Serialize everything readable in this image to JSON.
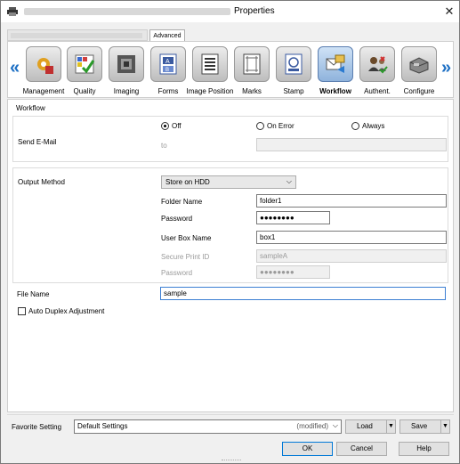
{
  "window": {
    "title": "Properties",
    "close": "✕"
  },
  "tabs": {
    "advanced": "Advanced"
  },
  "ribbon": {
    "items": [
      {
        "label": "Management",
        "icon": "management-icon"
      },
      {
        "label": "Quality",
        "icon": "quality-icon"
      },
      {
        "label": "Imaging",
        "icon": "imaging-icon"
      },
      {
        "label": "Forms",
        "icon": "forms-icon"
      },
      {
        "label": "Image Position",
        "icon": "image-position-icon"
      },
      {
        "label": "Marks",
        "icon": "marks-icon"
      },
      {
        "label": "Stamp",
        "icon": "stamp-icon"
      },
      {
        "label": "Workflow",
        "icon": "workflow-icon",
        "selected": true
      },
      {
        "label": "Authent.",
        "icon": "authentication-icon"
      },
      {
        "label": "Configure",
        "icon": "configure-icon"
      }
    ],
    "prev": "«",
    "next": "»"
  },
  "workflow": {
    "section_title": "Workflow",
    "send_email": {
      "label": "Send E-Mail",
      "options": [
        "Off",
        "On Error",
        "Always"
      ],
      "selected": "Off",
      "to_label": "to",
      "to_value": ""
    },
    "output": {
      "label": "Output Method",
      "method": "Store on HDD",
      "folder_name_label": "Folder Name",
      "folder_name": "folder1",
      "password_label": "Password",
      "password": "●●●●●●●●",
      "user_box_label": "User Box Name",
      "user_box": "box1",
      "secure_print_label": "Secure Print ID",
      "secure_print": "sampleA",
      "password2_label": "Password",
      "password2": "●●●●●●●●"
    },
    "file_name_label": "File Name",
    "file_name": "sample",
    "auto_duplex_label": "Auto Duplex Adjustment"
  },
  "favorite": {
    "label": "Favorite Setting",
    "value": "Default Settings",
    "modified": "(modified)",
    "load": "Load",
    "save": "Save"
  },
  "buttons": {
    "ok": "OK",
    "cancel": "Cancel",
    "help": "Help"
  }
}
